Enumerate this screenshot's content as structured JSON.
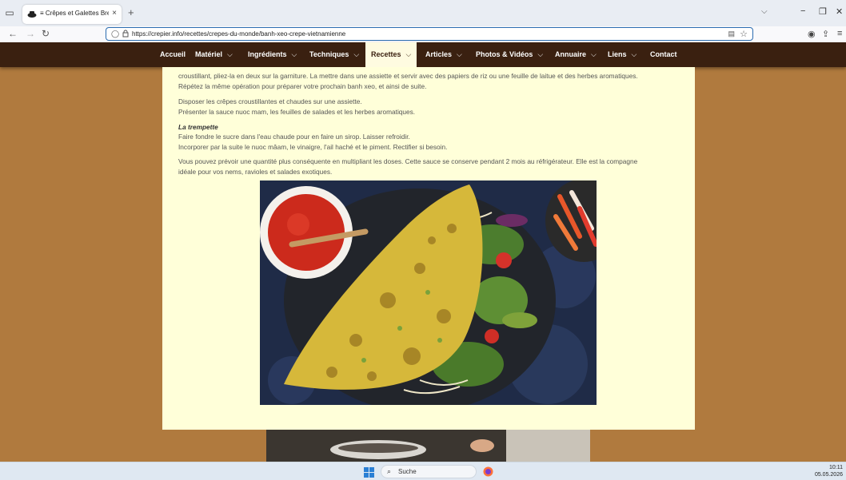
{
  "browser": {
    "tab_title": "≡ Crêpes et Galettes Bretonnes",
    "tab_close": "×",
    "new_tab": "+",
    "url": "https://crepier.info/recettes/crepes-du-monde/banh-xeo-crepe-vietnamienne"
  },
  "site_nav": {
    "items": [
      {
        "label": "Accueil",
        "has_dropdown": false
      },
      {
        "label": "Matériel",
        "has_dropdown": true
      },
      {
        "label": "Ingrédients",
        "has_dropdown": true
      },
      {
        "label": "Techniques",
        "has_dropdown": true
      },
      {
        "label": "Recettes",
        "has_dropdown": true,
        "active": true
      },
      {
        "label": "Articles",
        "has_dropdown": true
      },
      {
        "label": "Photos & Vidéos",
        "has_dropdown": true
      },
      {
        "label": "Annuaire",
        "has_dropdown": true
      },
      {
        "label": "Liens",
        "has_dropdown": true
      },
      {
        "label": "Contact",
        "has_dropdown": false
      }
    ],
    "chevron": "⌵"
  },
  "article": {
    "para1_line1": "croustillant, pliez-la en deux sur la garniture. La mettre dans une assiette et servir avec des papiers de riz ou une feuille de laitue et des herbes aromatiques.",
    "para1_line2": "Répétez la même opération pour préparer votre prochain banh xeo, et ainsi de suite.",
    "para2_line1": "Disposer les crêpes croustillantes et chaudes sur une assiette.",
    "para2_line2": "Présenter la sauce nuoc mam, les feuilles de salades et les herbes aromatiques.",
    "subheading": "La trempette",
    "para3_line1": "Faire fondre le sucre dans l'eau chaude pour en faire un sirop. Laisser refroidir.",
    "para3_line2": "Incorporer par la suite le nuoc mâam, le vinaigre, l'ail haché et le piment. Rectifier si besoin.",
    "para4_line1": "Vous pouvez prévoir une quantité plus conséquente en multipliant les doses. Cette sauce se conserve pendant 2 mois au réfrigérateur. Elle est la compagne",
    "para4_line2": "idéale pour vos nems, ravioles et salades exotiques."
  },
  "taskbar": {
    "search_label": "Suche",
    "time": "10:11",
    "date": "05.05.2026"
  },
  "colors": {
    "page_bg": "#b07a3e",
    "nav_bg": "#3a2010",
    "content_bg": "#ffffd9"
  }
}
